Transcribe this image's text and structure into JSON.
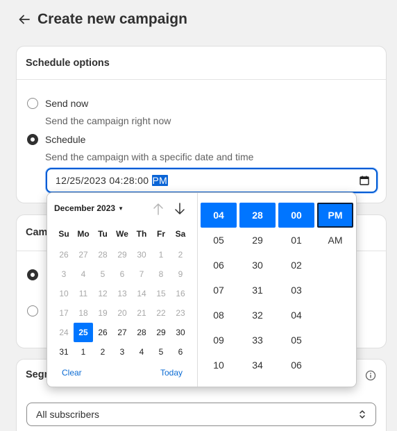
{
  "header": {
    "title": "Create new campaign"
  },
  "schedule": {
    "title": "Schedule options",
    "options": [
      {
        "label": "Send now",
        "help": "Send the campaign right now",
        "checked": false
      },
      {
        "label": "Schedule",
        "help": "Send the campaign with a specific date and time",
        "checked": true
      }
    ],
    "datetime": {
      "month": "12",
      "day": "25",
      "year": "2023",
      "hour": "04",
      "minute": "28",
      "second": "00",
      "ampm": "PM"
    }
  },
  "picker": {
    "month_label": "December 2023",
    "weekdays": [
      "Su",
      "Mo",
      "Tu",
      "We",
      "Th",
      "Fr",
      "Sa"
    ],
    "weeks": [
      [
        "26",
        "27",
        "28",
        "29",
        "30",
        "1",
        "2"
      ],
      [
        "3",
        "4",
        "5",
        "6",
        "7",
        "8",
        "9"
      ],
      [
        "10",
        "11",
        "12",
        "13",
        "14",
        "15",
        "16"
      ],
      [
        "17",
        "18",
        "19",
        "20",
        "21",
        "22",
        "23"
      ],
      [
        "24",
        "25",
        "26",
        "27",
        "28",
        "29",
        "30"
      ],
      [
        "31",
        "1",
        "2",
        "3",
        "4",
        "5",
        "6"
      ]
    ],
    "selected_day": "25",
    "clear_label": "Clear",
    "today_label": "Today",
    "hours": [
      "04",
      "05",
      "06",
      "07",
      "08",
      "09",
      "10"
    ],
    "minutes": [
      "28",
      "29",
      "30",
      "31",
      "32",
      "33",
      "34"
    ],
    "seconds": [
      "00",
      "01",
      "02",
      "03",
      "04",
      "05",
      "06"
    ],
    "ampm": [
      "PM",
      "AM"
    ]
  },
  "campaign_card": {
    "title_partial": "Cam"
  },
  "segment": {
    "title_partial": "Segm",
    "select_value": "All subscribers"
  },
  "colors": {
    "accent": "#0075ff",
    "input_focus": "#005bd3",
    "link": "#0b6bd3"
  }
}
